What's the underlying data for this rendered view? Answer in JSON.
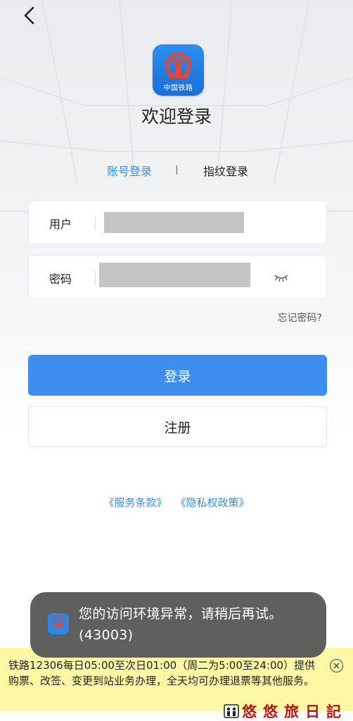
{
  "header": {
    "back_icon": "chevron-left-icon"
  },
  "app": {
    "logo_caption": "中国铁路",
    "logo_icon": "china-railway-logo"
  },
  "welcome_title": "欢迎登录",
  "tabs": {
    "account": "账号登录",
    "fingerprint": "指纹登录",
    "active": "account"
  },
  "form": {
    "username_label": "用户",
    "password_label": "密码",
    "forgot_password": "忘记密码?"
  },
  "buttons": {
    "login": "登录",
    "register": "注册"
  },
  "policy": {
    "terms": "《服务条款》",
    "privacy": "《隐私权政策》"
  },
  "toast": {
    "message": "您的访问环境异常，请稍后再试。(43003)"
  },
  "notice": {
    "text": "铁路12306每日05:00至次日01:00（周二为5:00至24:00）提供购票、改签、变更到站业务办理，全天均可办理退票等其他服务。"
  },
  "watermark": {
    "text": "悠悠旅日記"
  },
  "colors": {
    "accent": "#3e8eef",
    "notice_bg": "#fdf7a6",
    "toast_bg": "#555555",
    "watermark": "#b01818"
  }
}
